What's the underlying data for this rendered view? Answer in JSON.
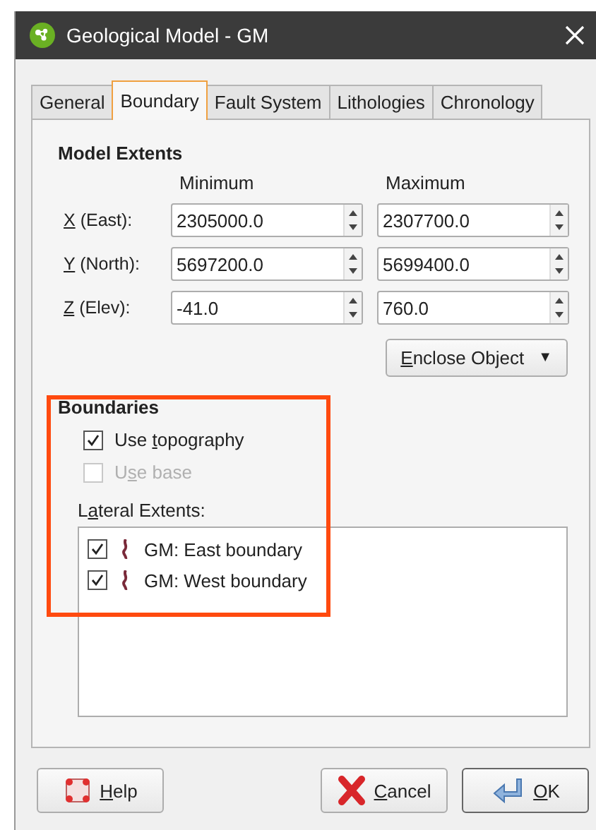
{
  "window": {
    "title": "Geological Model - GM"
  },
  "tabs": [
    {
      "label": "General",
      "selected": false
    },
    {
      "label": "Boundary",
      "selected": true
    },
    {
      "label": "Fault System",
      "selected": false
    },
    {
      "label": "Lithologies",
      "selected": false
    },
    {
      "label": "Chronology",
      "selected": false
    }
  ],
  "model_extents": {
    "title": "Model Extents",
    "columns": [
      "Minimum",
      "Maximum"
    ],
    "rows": [
      {
        "label": {
          "key": "X",
          "after": " (East):"
        },
        "minimum": "2305000.0",
        "maximum": "2307700.0"
      },
      {
        "label": {
          "key": "Y",
          "after": " (North):"
        },
        "minimum": "5697200.0",
        "maximum": "5699400.0"
      },
      {
        "label": {
          "key": "Z",
          "after": " (Elev):"
        },
        "minimum": "-41.0",
        "maximum": "760.0"
      }
    ],
    "enclose_button": {
      "label": {
        "key": "E",
        "after": "nclose Object"
      },
      "caret": "▼"
    }
  },
  "boundaries": {
    "title": "Boundaries",
    "options": [
      {
        "label": {
          "before": "Use ",
          "key": "t",
          "after": "opography"
        },
        "checked": true,
        "disabled": false
      },
      {
        "label": {
          "before": "U",
          "key": "s",
          "after": "e base"
        },
        "checked": false,
        "disabled": true
      }
    ],
    "lateral_label": {
      "before": "L",
      "key": "a",
      "after": "teral Extents:"
    },
    "lateral_items": [
      {
        "label": "GM: East boundary",
        "checked": true
      },
      {
        "label": "GM: West boundary",
        "checked": true
      }
    ]
  },
  "buttons": [
    {
      "kind": "help",
      "label": {
        "key": "H",
        "after": "elp"
      }
    },
    {
      "kind": "cancel",
      "label": {
        "key": "C",
        "after": "ancel"
      }
    },
    {
      "kind": "ok",
      "label": {
        "key": "O",
        "after": "K"
      }
    }
  ]
}
